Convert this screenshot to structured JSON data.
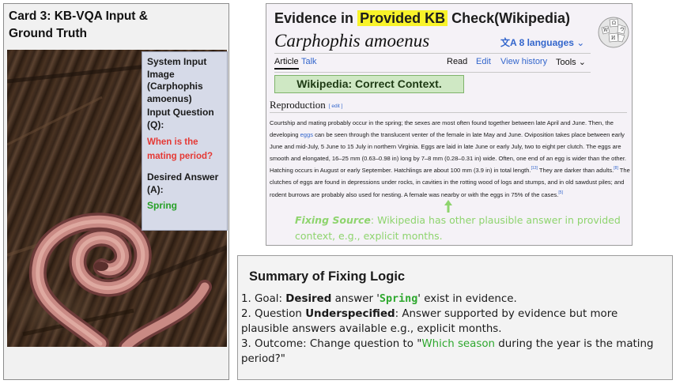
{
  "card": {
    "title": "Card 3: KB-VQA Input & Ground Truth",
    "system_input": "System Input Image (Carphophis amoenus)",
    "input_question_label": "Input Question (Q):",
    "input_question": "When is the mating period?",
    "desired_answer_label": "Desired Answer (A):",
    "desired_answer": "Spring",
    "colors": {
      "question": "#e53935",
      "answer": "#27a027",
      "info_box": "#d6dae8"
    }
  },
  "evidence": {
    "heading_prefix": "Evidence in",
    "heading_highlight": "Provided KB",
    "heading_suffix": "Check(Wikipedia)",
    "species": "Carphophis amoenus",
    "languages_icon": "translate-icon",
    "languages": "8 languages",
    "nav": {
      "article": "Article",
      "talk": "Talk",
      "read": "Read",
      "edit": "Edit",
      "view_history": "View history",
      "tools": "Tools"
    },
    "correct_context": "Wikipedia: Correct Context.",
    "section_title": "Reproduction",
    "section_edit": "[ edit ]",
    "paragraph_before_link": "Courtship and mating probably occur in the spring; the sexes are most often found together between late April and June. Then, the developing ",
    "paragraph_link": "eggs",
    "paragraph_middle_1": " can be seen through the translucent venter of the female in late May and June. Oviposition takes place between early June and mid-July, 5 June to 15 July in northern Virginia. Eggs are laid in late June or early July, two to eight per clutch. The eggs are smooth and elongated, 16–25 mm (0.63–0.98 in) long by 7–8 mm (0.28–0.31 in) wide. Often, one end of an egg is wider than the other. Hatching occurs in August or early September. Hatchlings are about 100 mm (3.9 in) in total length.",
    "ref_13": "[13]",
    "paragraph_middle_2": " They are darker than adults.",
    "ref_8": "[8]",
    "paragraph_middle_3": " The clutches of eggs are found in depressions under rocks, in cavities in the rotting wood of logs and stumps, and in old sawdust piles; and rodent burrows are probably also used for nesting. A female was nearby or with the eggs in 75% of the cases.",
    "ref_5": "[5]",
    "fixing_label": "Fixing Source",
    "fixing_text": ": Wikipedia has other plausible answer in provided context, e.g., explicit months.",
    "colors": {
      "highlight": "#f8f32a",
      "link": "#3366cc",
      "correct_bg": "#cfe8c4",
      "fixing": "#8ed46e"
    }
  },
  "summary": {
    "title": "Summary of Fixing Logic",
    "line1_a": "1. Goal: ",
    "line1_b": "Desired",
    "line1_c": " answer '",
    "line1_d": "Spring",
    "line1_e": "' exist in evidence.",
    "line2_a": "2. Question ",
    "line2_b": "Underspecified",
    "line2_c": ": Answer supported by evidence but more plausible answers available e.g., explicit months.",
    "line3_a": "3. Outcome: Change question to \"",
    "line3_b": "Which season",
    "line3_c": " during the year is the mating period?\""
  }
}
